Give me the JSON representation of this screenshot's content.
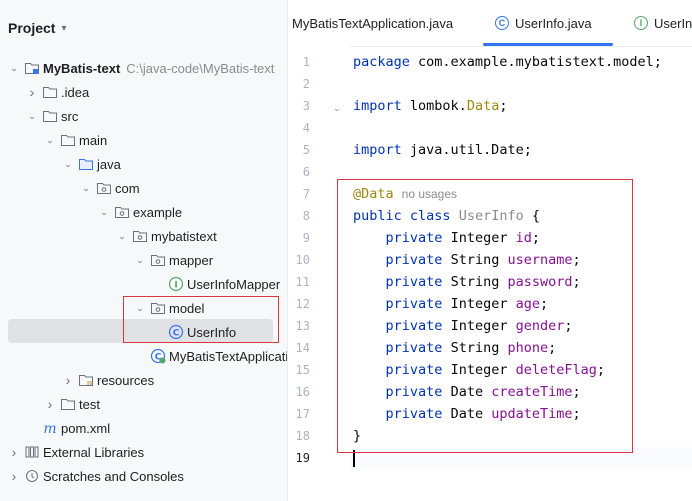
{
  "project_panel": {
    "title": "Project",
    "tree": [
      {
        "label": "MyBatis-text",
        "extra": "C:\\java-code\\MyBatis-text",
        "icon": "module-folder-icon",
        "arrow": "expanded"
      },
      {
        "label": ".idea",
        "icon": "folder-icon",
        "arrow": "collapsed"
      },
      {
        "label": "src",
        "icon": "folder-icon",
        "arrow": "expanded"
      },
      {
        "label": "main",
        "icon": "folder-icon",
        "arrow": "expanded"
      },
      {
        "label": "java",
        "icon": "source-folder-icon",
        "arrow": "expanded"
      },
      {
        "label": "com",
        "icon": "package-icon",
        "arrow": "expanded"
      },
      {
        "label": "example",
        "icon": "package-icon",
        "arrow": "expanded"
      },
      {
        "label": "mybatistext",
        "icon": "package-icon",
        "arrow": "expanded"
      },
      {
        "label": "mapper",
        "icon": "package-icon",
        "arrow": "expanded"
      },
      {
        "label": "UserInfoMapper",
        "icon": "interface-icon",
        "arrow": "none"
      },
      {
        "label": "model",
        "icon": "package-icon",
        "arrow": "expanded"
      },
      {
        "label": "UserInfo",
        "icon": "class-icon",
        "arrow": "none"
      },
      {
        "label": "MyBatisTextApplicati",
        "icon": "spring-class-icon",
        "arrow": "none"
      },
      {
        "label": "resources",
        "icon": "resources-folder-icon",
        "arrow": "collapsed"
      },
      {
        "label": "test",
        "icon": "folder-icon",
        "arrow": "collapsed"
      },
      {
        "label": "pom.xml",
        "icon": "maven-icon",
        "arrow": "none"
      },
      {
        "label": "External Libraries",
        "icon": "libraries-icon",
        "arrow": "collapsed"
      },
      {
        "label": "Scratches and Consoles",
        "icon": "scratches-icon",
        "arrow": "collapsed"
      }
    ]
  },
  "editor": {
    "tabs": [
      {
        "label": "MyBatisTextApplication.java",
        "icon": "none",
        "active": false
      },
      {
        "label": "UserInfo.java",
        "icon": "class-icon",
        "active": true
      },
      {
        "label": "UserIn",
        "icon": "interface-icon",
        "active": false
      }
    ],
    "line_numbers": [
      "1",
      "2",
      "3",
      "4",
      "5",
      "6",
      "7",
      "8",
      "9",
      "10",
      "11",
      "12",
      "13",
      "14",
      "15",
      "16",
      "17",
      "18",
      "19"
    ],
    "code": {
      "l1_kw": "package",
      "l1_rest": " com.example.mybatistext.model;",
      "l3_kw": "import",
      "l3_rest": " lombok.",
      "l3_cls": "Data",
      "l3_end": ";",
      "l5_kw": "import",
      "l5_rest": " java.util.Date;",
      "l7_ann": "@Data",
      "l7_hint": "no usages",
      "l8_kw1": "public",
      "l8_kw2": "class",
      "l8_cls": "UserInfo",
      "l8_end": " {",
      "private": "private",
      "fields": [
        {
          "type": "Integer",
          "name": "id"
        },
        {
          "type": "String",
          "name": "username"
        },
        {
          "type": "String",
          "name": "password"
        },
        {
          "type": "Integer",
          "name": "age"
        },
        {
          "type": "Integer",
          "name": "gender"
        },
        {
          "type": "String",
          "name": "phone"
        },
        {
          "type": "Integer",
          "name": "deleteFlag"
        },
        {
          "type": "Date",
          "name": "createTime"
        },
        {
          "type": "Date",
          "name": "updateTime"
        }
      ],
      "l18": "}"
    }
  },
  "colors": {
    "accent": "#3574f0",
    "highlight_box": "#d9363e"
  }
}
